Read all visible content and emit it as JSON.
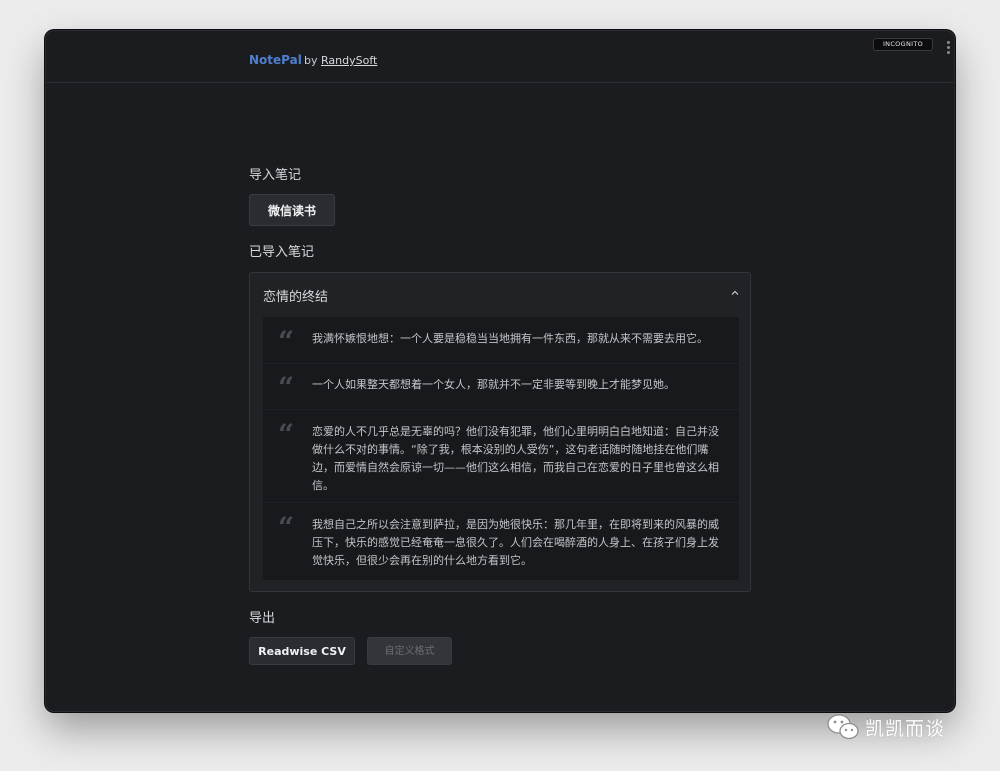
{
  "header": {
    "brand": "NotePal",
    "by_prefix": "by",
    "author": "RandySoft",
    "incognito_badge": "INCOGNITO"
  },
  "import": {
    "title": "导入笔记",
    "source_button": "微信读书"
  },
  "imported": {
    "title": "已导入笔记",
    "book_title": "恋情的终结",
    "highlights": [
      "我满怀嫉恨地想：一个人要是稳稳当当地拥有一件东西，那就从来不需要去用它。",
      "一个人如果整天都想着一个女人，那就并不一定非要等到晚上才能梦见她。",
      "恋爱的人不几乎总是无辜的吗？他们没有犯罪，他们心里明明白白地知道：自己并没做什么不对的事情。“除了我，根本没别的人受伤”，这句老话随时随地挂在他们嘴边，而爱情自然会原谅一切——他们这么相信，而我自己在恋爱的日子里也曾这么相信。",
      "我想自己之所以会注意到萨拉，是因为她很快乐：那几年里，在即将到来的风暴的威压下，快乐的感觉已经奄奄一息很久了。人们会在喝醉酒的人身上、在孩子们身上发觉快乐，但很少会再在别的什么地方看到它。"
    ]
  },
  "export": {
    "title": "导出",
    "readwise_button": "Readwise CSV",
    "custom_button": "自定义格式"
  },
  "watermark": {
    "text": "凯凯而谈"
  },
  "colors": {
    "background": "#1b1c20",
    "brand": "#4f7fd0",
    "panel": "#212226",
    "quote_block": "#18191c"
  }
}
